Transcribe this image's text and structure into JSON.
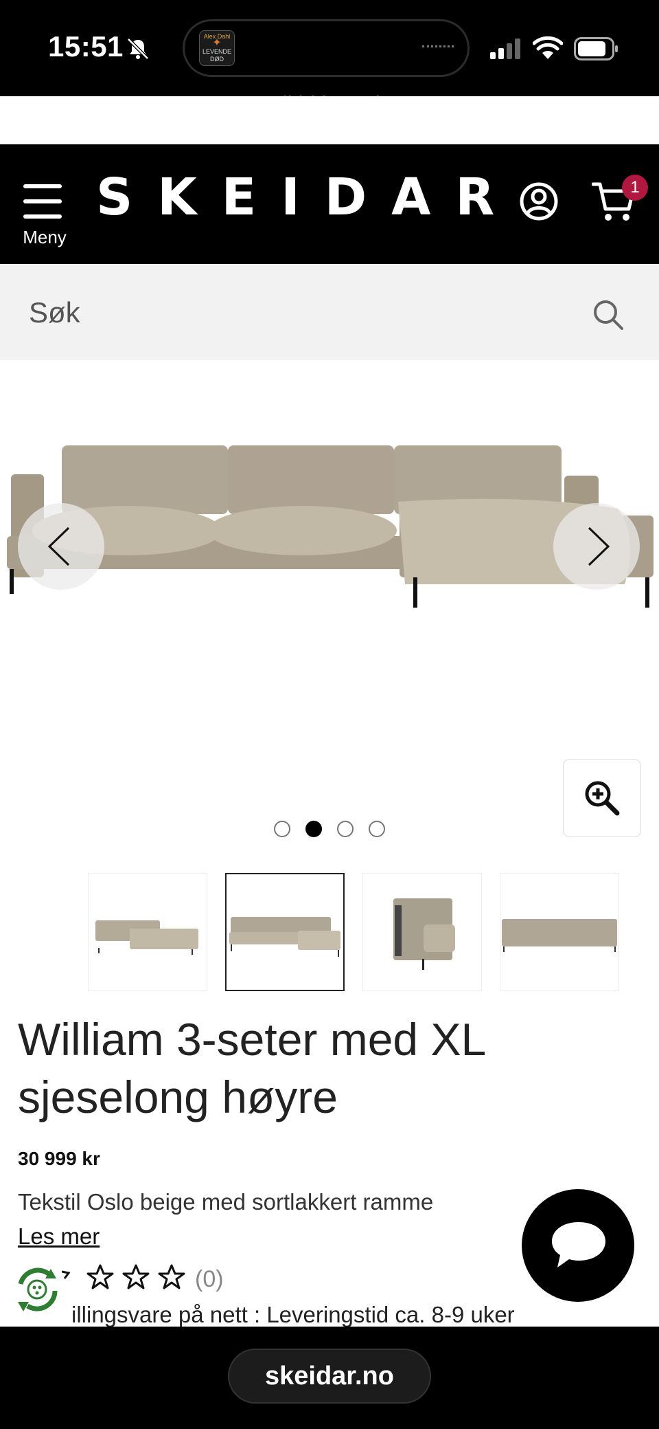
{
  "status_bar": {
    "time": "15:51",
    "island_app_text": [
      "Alex Dahl",
      "LEVENDE",
      "DØD"
    ],
    "icons": [
      "bell-muted-icon",
      "signal-icon",
      "wifi-icon",
      "battery-icon"
    ]
  },
  "promo": {
    "text": "Alltid lav pris"
  },
  "header": {
    "menu_label": "Meny",
    "logo": "SKEIDAR",
    "cart_count": "1",
    "icons": [
      "hamburger-icon",
      "account-icon",
      "cart-icon"
    ],
    "badge_color": "#b0183f"
  },
  "search": {
    "placeholder": "Søk",
    "icon": "search-icon"
  },
  "gallery": {
    "main_image": "corner-sofa-photo",
    "dots": [
      false,
      true,
      false,
      false
    ],
    "thumbnails": [
      "sofa-angle-thumb",
      "sofa-front-thumb",
      "sofa-side-thumb",
      "sofa-back-thumb"
    ],
    "selected_thumbnail": 1
  },
  "product": {
    "title_line1": "William 3-seter med XL",
    "title_line2": "sjeselong høyre",
    "price": "30 999 kr",
    "description": "Tekstil Oslo beige med sortlakkert ramme",
    "read_more": "Les mer",
    "rating_count": "(0)",
    "rating_stars_visible": 4,
    "delivery": "illingsvare på nett : Leveringstid ca. 8-9 uker"
  },
  "browser": {
    "url": "skeidar.no"
  }
}
